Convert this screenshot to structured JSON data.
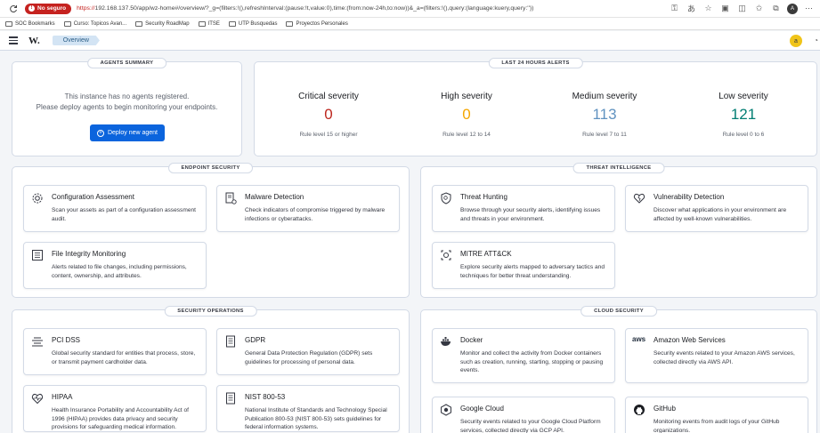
{
  "browser": {
    "not_secure_label": "No seguro",
    "url_proto": "https://",
    "url_rest": "192.168.137.50/app/wz-home#/overview/?_g=(filters:!(),refreshInterval:(pause:!t,value:0),time:(from:now-24h,to:now))&_a=(filters:!(),query:(language:kuery,query:''))",
    "profile_initials": "A",
    "bookmarks": [
      "SOC Bookmarks",
      "Curso: Topicos Avan...",
      "Security RoadMap",
      "ITSE",
      "UTP Busquedas",
      "Proyectos Personales"
    ]
  },
  "header": {
    "logo": "W.",
    "breadcrumb": "Overview",
    "user_initial": "a"
  },
  "agents_summary": {
    "title": "AGENTS SUMMARY",
    "line1": "This instance has no agents registered.",
    "line2": "Please deploy agents to begin monitoring your endpoints.",
    "deploy_button": "Deploy new agent"
  },
  "alerts": {
    "title": "LAST 24 HOURS ALERTS",
    "items": [
      {
        "label": "Critical severity",
        "count": "0",
        "rule": "Rule level 15 or higher",
        "color": "#bd271e"
      },
      {
        "label": "High severity",
        "count": "0",
        "rule": "Rule level 12 to 14",
        "color": "#f5a700"
      },
      {
        "label": "Medium severity",
        "count": "113",
        "rule": "Rule level 7 to 11",
        "color": "#6092c0"
      },
      {
        "label": "Low severity",
        "count": "121",
        "rule": "Rule level 0 to 6",
        "color": "#017d73"
      }
    ]
  },
  "sections": {
    "endpoint": {
      "title": "ENDPOINT SECURITY",
      "cards": [
        {
          "title": "Configuration Assessment",
          "desc": "Scan your assets as part of a configuration assessment audit."
        },
        {
          "title": "Malware Detection",
          "desc": "Check indicators of compromise triggered by malware infections or cyberattacks."
        },
        {
          "title": "File Integrity Monitoring",
          "desc": "Alerts related to file changes, including permissions, content, ownership, and attributes."
        }
      ]
    },
    "threat": {
      "title": "THREAT INTELLIGENCE",
      "cards": [
        {
          "title": "Threat Hunting",
          "desc": "Browse through your security alerts, identifying issues and threats in your environment."
        },
        {
          "title": "Vulnerability Detection",
          "desc": "Discover what applications in your environment are affected by well-known vulnerabilities."
        },
        {
          "title": "MITRE ATT&CK",
          "desc": "Explore security alerts mapped to adversary tactics and techniques for better threat understanding."
        }
      ]
    },
    "secops": {
      "title": "SECURITY OPERATIONS",
      "cards": [
        {
          "title": "PCI DSS",
          "desc": "Global security standard for entities that process, store, or transmit payment cardholder data."
        },
        {
          "title": "GDPR",
          "desc": "General Data Protection Regulation (GDPR) sets guidelines for processing of personal data."
        },
        {
          "title": "HIPAA",
          "desc": "Health Insurance Portability and Accountability Act of 1996 (HIPAA) provides data privacy and security provisions for safeguarding medical information."
        },
        {
          "title": "NIST 800-53",
          "desc": "National Institute of Standards and Technology Special Publication 800-53 (NIST 800-53) sets guidelines for federal information systems."
        }
      ]
    },
    "cloud": {
      "title": "CLOUD SECURITY",
      "cards": [
        {
          "title": "Docker",
          "desc": "Monitor and collect the activity from Docker containers such as creation, running, starting, stopping or pausing events."
        },
        {
          "title": "Amazon Web Services",
          "desc": "Security events related to your Amazon AWS services, collected directly via AWS API."
        },
        {
          "title": "Google Cloud",
          "desc": "Security events related to your Google Cloud Platform services, collected directly via GCP API."
        },
        {
          "title": "GitHub",
          "desc": "Monitoring events from audit logs of your GitHub organizations."
        }
      ]
    }
  },
  "icons": {
    "aws_text": "aws"
  }
}
